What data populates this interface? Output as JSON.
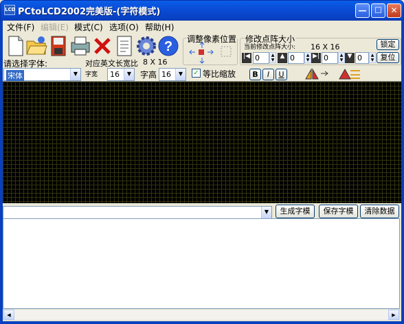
{
  "window": {
    "title": "PCtoLCD2002完美版-(字符模式)",
    "app_icon_text": "LCD",
    "minimize_glyph": "—",
    "maximize_glyph": "☐",
    "close_glyph": "✕"
  },
  "menu": {
    "items": [
      {
        "label": "文件(F)",
        "enabled": true
      },
      {
        "label": "编辑(E)",
        "enabled": false
      },
      {
        "label": "模式(C)",
        "enabled": true
      },
      {
        "label": "选项(O)",
        "enabled": true
      },
      {
        "label": "帮助(H)",
        "enabled": true
      }
    ]
  },
  "toolbar": {
    "icons": [
      "new-file-icon",
      "open-folder-icon",
      "save-disk-icon",
      "print-icon",
      "delete-icon",
      "notes-icon",
      "settings-gear-icon",
      "help-icon"
    ]
  },
  "font_select": {
    "label": "请选择字体:",
    "value": "宋体"
  },
  "ratio": {
    "label": "对应英文长宽比",
    "value": "8 X 16"
  },
  "width_select": {
    "label": "字宽",
    "value": "16"
  },
  "height_select": {
    "label": "字高",
    "value": "16"
  },
  "proportional": {
    "label": "等比缩放",
    "checked": true
  },
  "adjust_pixel": {
    "label": "调整像素位置"
  },
  "resize": {
    "label": "修改点阵大小",
    "current_label": "当前修改点阵大小:",
    "current_value": "16 X 16",
    "lock_label": "锁定",
    "reset_label": "复位",
    "spinners": [
      "0",
      "0",
      "0",
      "0"
    ]
  },
  "format_buttons": [
    "B",
    "I",
    "U"
  ],
  "actions": {
    "generate": "生成字模",
    "save": "保存字模",
    "clear": "清除数据"
  },
  "input": {
    "value": ""
  },
  "colors": {
    "accent": "#0a4ad4",
    "grid_bg": "#000000",
    "grid_line": "#34340f"
  }
}
